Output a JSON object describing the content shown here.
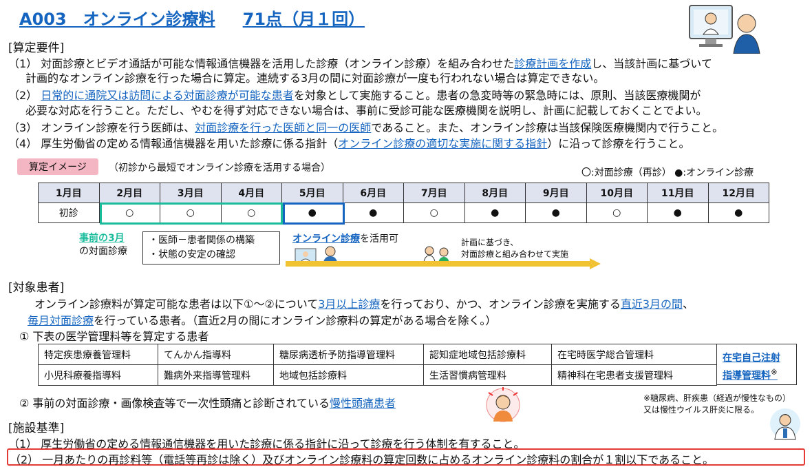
{
  "header": {
    "title": "A003　オンライン診療料",
    "points": "71点（月１回）"
  },
  "santei": {
    "heading": "[算定要件]",
    "item1_a": "（1）  対面診療とビデオ通話が可能な情報通信機器を活用した診療（オンライン診療）を組み合わせた",
    "item1_link": "診療計画を作成",
    "item1_b": "し、当該計画に基づいて",
    "item1_c": "計画的なオンライン診療を行った場合に算定。連続する3月の間に対面診療が一度も行われない場合は算定できない。",
    "item2_a": "（2）  ",
    "item2_link": "日常的に通院又は訪問による対面診療が可能な患者",
    "item2_b": "を対象として実施すること。患者の急変時等の緊急時には、原則、当該医療機関が",
    "item2_c": "必要な対応を行うこと。ただし、やむを得ず対応できない場合は、事前に受診可能な医療機関を説明し、計画に記載しておくことでよい。",
    "item3_a": "（3）  オンライン診療を行う医師は、",
    "item3_link": "対面診療を行った医師と同一の医師",
    "item3_b": "であること。また、オンライン診療は当該保険医療機関内で行うこと。",
    "item4_a": "（4）  厚生労働省の定める情報通信機器を用いた診療に係る指針（",
    "item4_link": "オンライン診療の適切な実施に関する指針",
    "item4_b": "）に沿って診療を行うこと。"
  },
  "image": {
    "tag": "算定イメージ",
    "note": "（初診から最短でオンライン診療を活用する場合）",
    "legend": "〇:対面診療（再診）  ●:オンライン診療",
    "months": [
      "1月目",
      "2月目",
      "3月目",
      "4月目",
      "5月目",
      "6月目",
      "7月目",
      "8月目",
      "9月目",
      "10月目",
      "11月目",
      "12月目"
    ],
    "marks": [
      "初診",
      "○",
      "○",
      "○",
      "●",
      "●",
      "○",
      "●",
      "●",
      "○",
      "●",
      "●"
    ],
    "prior_a": "事前の3月",
    "prior_b": "の対面診療",
    "cond1": "・医師－患者関係の構築",
    "cond2": "・状態の安定の確認",
    "online_link": "オンライン診療",
    "online_rest": "を活用可",
    "plan1": "計画に基づき、",
    "plan2": "対面診療と組み合わせて実施"
  },
  "taisho": {
    "heading": "[対象患者]",
    "p1_a": "オンライン診療料が算定可能な患者は以下①～②について",
    "p1_link1": "3月以上診療",
    "p1_b": "を行っており、かつ、オンライン診療を実施する",
    "p1_link2": "直近3月の間",
    "p1_c": "、",
    "p2_link": "毎月対面診療",
    "p2_b": "を行っている患者。（直近2月の間にオンライン診療料の算定がある場合を除く。）",
    "sub1": "①  下表の医学管理料等を算定する患者",
    "table": [
      [
        "特定疾患療養管理料",
        "てんかん指導料",
        "糖尿病透析予防指導管理料",
        "認知症地域包括診療料",
        "在宅時医学総合管理料"
      ],
      [
        "小児科療養指導料",
        "難病外来指導管理料",
        "地域包括診療料",
        "生活習慣病管理料",
        "精神科在宅患者支援管理料"
      ]
    ],
    "zaitaku1": "在宅自己注射",
    "zaitaku2": "指導管理料",
    "zaitaku_mark": "※",
    "sub2_a": "②  事前の対面診療・画像検査等で一次性頭痛と診断されている",
    "sub2_link": "慢性頭痛患者",
    "note1": "※糖尿病、肝疾患（経過が慢性なもの）",
    "note2": "又は慢性ウイルス肝炎に限る。"
  },
  "shisetsu": {
    "heading": "[施設基準]",
    "item1": "（1）  厚生労働省の定める情報通信機器を用いた診療に係る指針に沿って診療を行う体制を有すること。",
    "item2": "（2）  一月あたりの再診料等（電話等再診は除く）及びオンライン診療料の算定回数に占めるオンライン診療料の割合が１割以下であること。"
  }
}
